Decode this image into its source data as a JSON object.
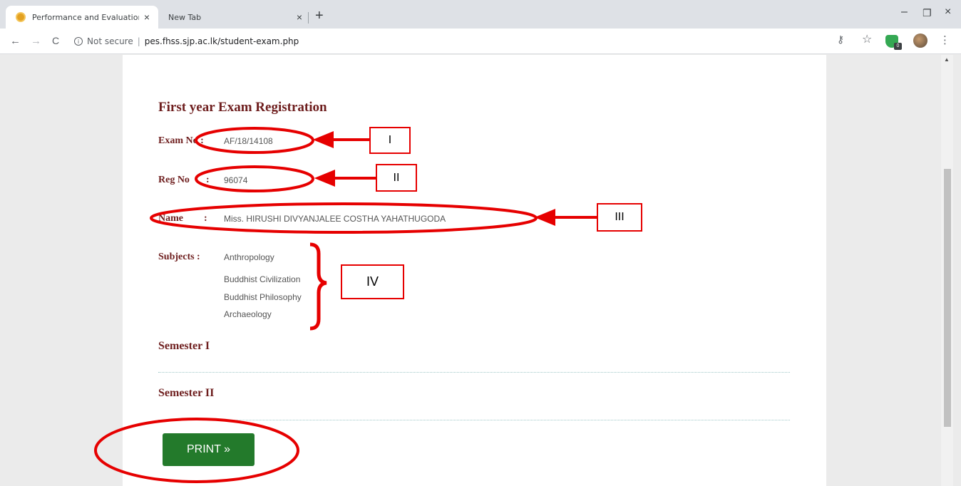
{
  "browser": {
    "tabs": [
      {
        "title": "Performance and Evaluation Serv",
        "close": "×"
      },
      {
        "title": "New Tab",
        "close": "×"
      }
    ],
    "new_tab": "+",
    "window_controls": {
      "minimize": "–",
      "maximize": "❐",
      "close": "×"
    },
    "nav": {
      "back": "←",
      "forward": "→",
      "reload": "C"
    },
    "address": {
      "info_glyph": "i",
      "security_text": "Not secure",
      "divider": "|",
      "url": "pes.fhss.sjp.ac.lk/student-exam.php"
    },
    "toolbar_icons": {
      "key": "⚷",
      "star": "☆",
      "extension_badge": "0",
      "menu": "⋮"
    }
  },
  "page": {
    "heading": "First year Exam Registration",
    "exam_no_label": "Exam No :",
    "exam_no_value": "AF/18/14108",
    "reg_no_label": "Reg No",
    "reg_no_colon": ":",
    "reg_no_value": "96074",
    "name_label": "Name",
    "name_colon": ":",
    "name_value": "Miss. HIRUSHI DIVYANJALEE COSTHA YAHATHUGODA",
    "subjects_label": "Subjects :",
    "subjects": [
      "Anthropology",
      "Buddhist Civilization",
      "Buddhist Philosophy",
      "Archaeology"
    ],
    "semester_1": "Semester I",
    "semester_2": "Semester II",
    "print_button": "PRINT  »"
  },
  "annotations": {
    "labels": [
      "I",
      "II",
      "III",
      "IV"
    ],
    "color": "#e60000"
  },
  "colors": {
    "heading": "#6e1e1e",
    "print_button": "#237a2b",
    "annotation": "#e60000"
  }
}
